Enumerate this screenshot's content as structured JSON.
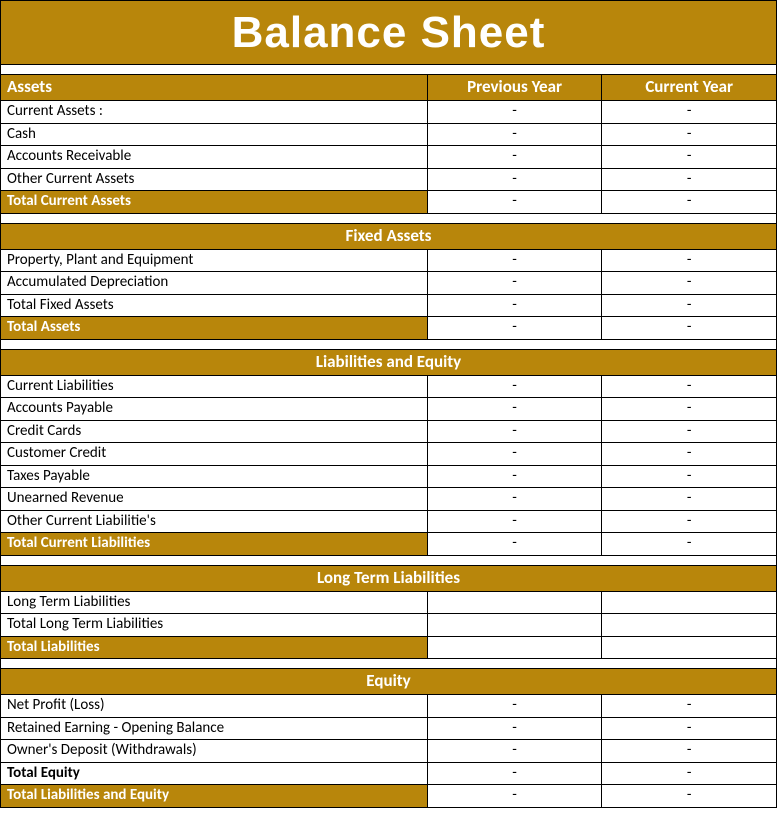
{
  "title": "Balance Sheet",
  "columns": {
    "label": "Assets",
    "previous": "Previous Year",
    "current": "Current Year"
  },
  "sections": [
    {
      "name": "assets",
      "header": null,
      "rows": [
        {
          "label": "Current Assets :",
          "prev": "-",
          "cur": "-"
        },
        {
          "label": "Cash",
          "prev": "-",
          "cur": "-"
        },
        {
          "label": "Accounts Receivable",
          "prev": "-",
          "cur": "-"
        },
        {
          "label": "Other Current Assets",
          "prev": "-",
          "cur": "-"
        }
      ],
      "subtotal": {
        "label": "Total Current Assets",
        "prev": "-",
        "cur": "-"
      }
    },
    {
      "name": "fixed-assets",
      "header": "Fixed Assets",
      "rows": [
        {
          "label": "Property, Plant and Equipment",
          "prev": "-",
          "cur": "-"
        },
        {
          "label": "Accumulated Depreciation",
          "prev": "-",
          "cur": "-"
        },
        {
          "label": "Total Fixed Assets",
          "prev": "-",
          "cur": "-"
        }
      ],
      "subtotal": {
        "label": "Total Assets",
        "prev": "-",
        "cur": "-"
      }
    },
    {
      "name": "liabilities-equity",
      "header": "Liabilities and Equity",
      "rows": [
        {
          "label": "Current Liabilities",
          "prev": "-",
          "cur": "-"
        },
        {
          "label": "Accounts Payable",
          "prev": "-",
          "cur": "-"
        },
        {
          "label": "Credit Cards",
          "prev": "-",
          "cur": "-"
        },
        {
          "label": "Customer Credit",
          "prev": "-",
          "cur": "-"
        },
        {
          "label": "Taxes Payable",
          "prev": "-",
          "cur": "-"
        },
        {
          "label": "Unearned Revenue",
          "prev": "-",
          "cur": "-"
        },
        {
          "label": "Other Current Liabilitie's",
          "prev": "-",
          "cur": "-"
        }
      ],
      "subtotal": {
        "label": "Total Current Liabilities",
        "prev": "-",
        "cur": "-"
      }
    },
    {
      "name": "long-term-liabilities",
      "header": "Long Term Liabilities",
      "rows": [
        {
          "label": "Long Term Liabilities",
          "prev": "",
          "cur": ""
        },
        {
          "label": "Total Long Term Liabilities",
          "prev": "",
          "cur": ""
        }
      ],
      "subtotal": {
        "label": "Total Liabilities",
        "prev": "",
        "cur": ""
      }
    },
    {
      "name": "equity",
      "header": "Equity",
      "rows": [
        {
          "label": "Net Profit (Loss)",
          "prev": "-",
          "cur": "-"
        },
        {
          "label": "Retained Earning - Opening Balance",
          "prev": "-",
          "cur": "-"
        },
        {
          "label": "Owner's Deposit (Withdrawals)",
          "prev": "-",
          "cur": "-"
        }
      ],
      "equity_total": {
        "label": "Total Equity",
        "prev": "-",
        "cur": "-"
      },
      "subtotal": {
        "label": "Total Liabilities and Equity",
        "prev": "-",
        "cur": "-"
      }
    }
  ]
}
